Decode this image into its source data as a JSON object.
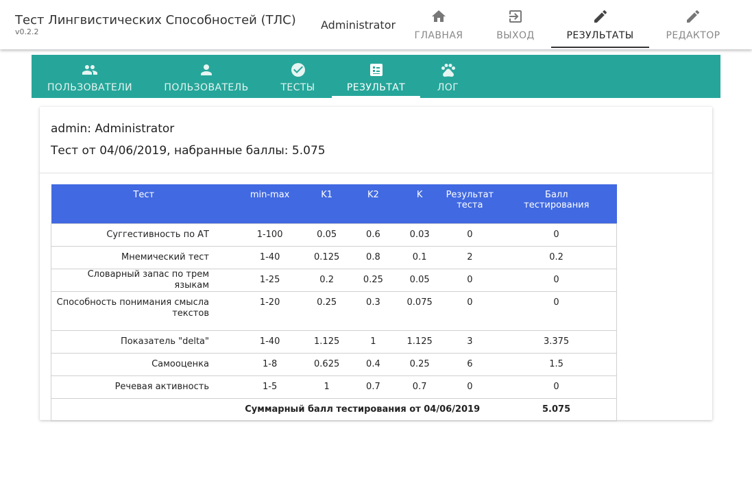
{
  "app": {
    "title": "Тест Лингвистических Способностей (ТЛС)",
    "version": "v0.2.2",
    "user": "Administrator"
  },
  "nav": [
    {
      "label": "ГЛАВНАЯ",
      "icon": "home-icon"
    },
    {
      "label": "ВЫХОД",
      "icon": "logout-icon"
    },
    {
      "label": "РЕЗУЛЬТАТЫ",
      "icon": "pencil-icon",
      "active": true
    },
    {
      "label": "РЕДАКТОР",
      "icon": "pencil-icon"
    }
  ],
  "tabs": [
    {
      "label": "ПОЛЬЗОВАТЕЛИ",
      "icon": "people-icon"
    },
    {
      "label": "ПОЛЬЗОВАТЕЛЬ",
      "icon": "person-icon"
    },
    {
      "label": "ТЕСТЫ",
      "icon": "check-circle-icon"
    },
    {
      "label": "РЕЗУЛЬТАТ",
      "icon": "list-alt-icon",
      "active": true
    },
    {
      "label": "ЛОГ",
      "icon": "paw-icon"
    }
  ],
  "colors": {
    "tabbar": "#26a69a",
    "table_header": "#4169e1"
  },
  "card": {
    "user_line": "admin: Administrator",
    "score_line": "Тест от 04/06/2019, набранные баллы: 5.075"
  },
  "table": {
    "headers": [
      "Тест",
      "min-max",
      "K1",
      "K2",
      "K",
      "Результат теста",
      "Балл тестирования"
    ],
    "rows": [
      [
        "Суггестивность по АТ",
        "1-100",
        "0.05",
        "0.6",
        "0.03",
        "0",
        "0"
      ],
      [
        "Мнемический тест",
        "1-40",
        "0.125",
        "0.8",
        "0.1",
        "2",
        "0.2"
      ],
      [
        "Словарный запас по трем языкам",
        "1-25",
        "0.2",
        "0.25",
        "0.05",
        "0",
        "0"
      ],
      [
        "Способность понимания смысла текстов",
        "1-20",
        "0.25",
        "0.3",
        "0.075",
        "0",
        "0"
      ],
      [
        "Показатель \"delta\"",
        "1-40",
        "1.125",
        "1",
        "1.125",
        "3",
        "3.375"
      ],
      [
        "Самооценка",
        "1-8",
        "0.625",
        "0.4",
        "0.25",
        "6",
        "1.5"
      ],
      [
        "Речевая активность",
        "1-5",
        "1",
        "0.7",
        "0.7",
        "0",
        "0"
      ]
    ],
    "total_label": "Суммарный балл тестирования от 04/06/2019",
    "total_value": "5.075"
  }
}
